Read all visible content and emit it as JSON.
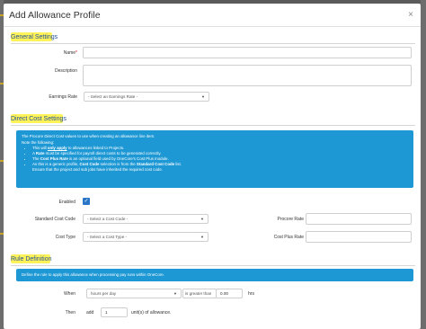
{
  "modal": {
    "title": "Add Allowance Profile",
    "close": "×"
  },
  "general": {
    "title": "General Settings",
    "name_label": "Name",
    "name_required": "*",
    "description_label": "Description",
    "earnings_rate_label": "Earnings Rate",
    "earnings_rate_value": "- Select an Earnings Rate -"
  },
  "direct_cost": {
    "title": "Direct Cost Settings",
    "info_intro": "The Procore Direct Cost values to use when creating an allowance line item.",
    "info_note": "Note the following:",
    "bullets": [
      {
        "pre": "This will ",
        "bold": "only apply",
        "post": " to allowances linked to Projects."
      },
      {
        "pre": "A ",
        "bold": "Rate",
        "post": " must be specified for payroll direct costs to be generated correctly."
      },
      {
        "pre": "The ",
        "bold": "Cost Plus Rate",
        "post": " is an optional field used by OneCore's Cost Plus module."
      },
      {
        "pre": "As this is a generic profile, ",
        "bold": "Cost Code",
        "post": " selection is from the "
      },
      {
        "pre": "Ensure that the project and sub jobs have inherited the required cost code.",
        "bold": "",
        "post": ""
      }
    ],
    "bullet4_bold2": "Standard Cost Code",
    "bullet4_tail": " list.",
    "enabled_label": "Enabled",
    "enabled_check": "✓",
    "std_cost_code_label": "Standard Cost Code",
    "std_cost_code_value": "- Select a Cost Code -",
    "procore_rate_label": "Procore Rate",
    "cost_type_label": "Cost Type",
    "cost_type_value": "- Select a Cost Type -",
    "cost_plus_rate_label": "Cost Plus Rate"
  },
  "rule": {
    "title": "Rule Definition",
    "info": "Define the rule to apply this allowance when processing pay runs within OneCore.",
    "when_label": "When",
    "when_value": "hours per day",
    "comparator_value": "is greater than",
    "threshold_value": "0.00",
    "threshold_unit": "hrs",
    "then_label": "Then",
    "add_label": "add",
    "add_value": "1",
    "add_unit": "unit(s) of allowance."
  },
  "colors": {
    "accent": "#1d98d4",
    "section": "#1f4f9a",
    "highlight": "#ffec00"
  }
}
